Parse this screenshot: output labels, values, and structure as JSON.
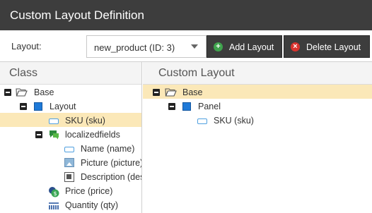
{
  "window": {
    "title": "Custom Layout Definition"
  },
  "toolbar": {
    "layout_label": "Layout:",
    "layout_value": "new_product (ID: 3)",
    "add_label": "Add Layout",
    "delete_label": "Delete Layout"
  },
  "class_panel": {
    "title": "Class",
    "tree": [
      {
        "label": "Base",
        "icon": "folder-icon",
        "expanded": true,
        "selected": false
      },
      {
        "label": "Layout",
        "icon": "panel-icon",
        "expanded": true,
        "selected": false
      },
      {
        "label": "SKU (sku)",
        "icon": "input-icon",
        "selected": true
      },
      {
        "label": "localizedfields",
        "icon": "localized-icon",
        "expanded": true,
        "selected": false
      },
      {
        "label": "Name (name)",
        "icon": "input-icon",
        "selected": false
      },
      {
        "label": "Picture (picture)",
        "icon": "image-icon",
        "selected": false
      },
      {
        "label": "Description (description)",
        "icon": "wysiwyg-icon",
        "selected": false
      },
      {
        "label": "Price (price)",
        "icon": "price-icon",
        "selected": false
      },
      {
        "label": "Quantity (qty)",
        "icon": "quantity-icon",
        "selected": false
      }
    ]
  },
  "layout_panel": {
    "title": "Custom Layout",
    "tree": [
      {
        "label": "Base",
        "icon": "folder-icon",
        "expanded": true,
        "selected": true
      },
      {
        "label": "Panel",
        "icon": "panel-icon",
        "expanded": true,
        "selected": false
      },
      {
        "label": "SKU (sku)",
        "icon": "input-icon",
        "selected": false
      }
    ]
  },
  "colors": {
    "title_bar": "#3d3d3d",
    "selection": "#fbe8b8",
    "add_icon": "#3fa34d",
    "delete_icon": "#d9332e",
    "panel_icon": "#1f7ad8"
  }
}
